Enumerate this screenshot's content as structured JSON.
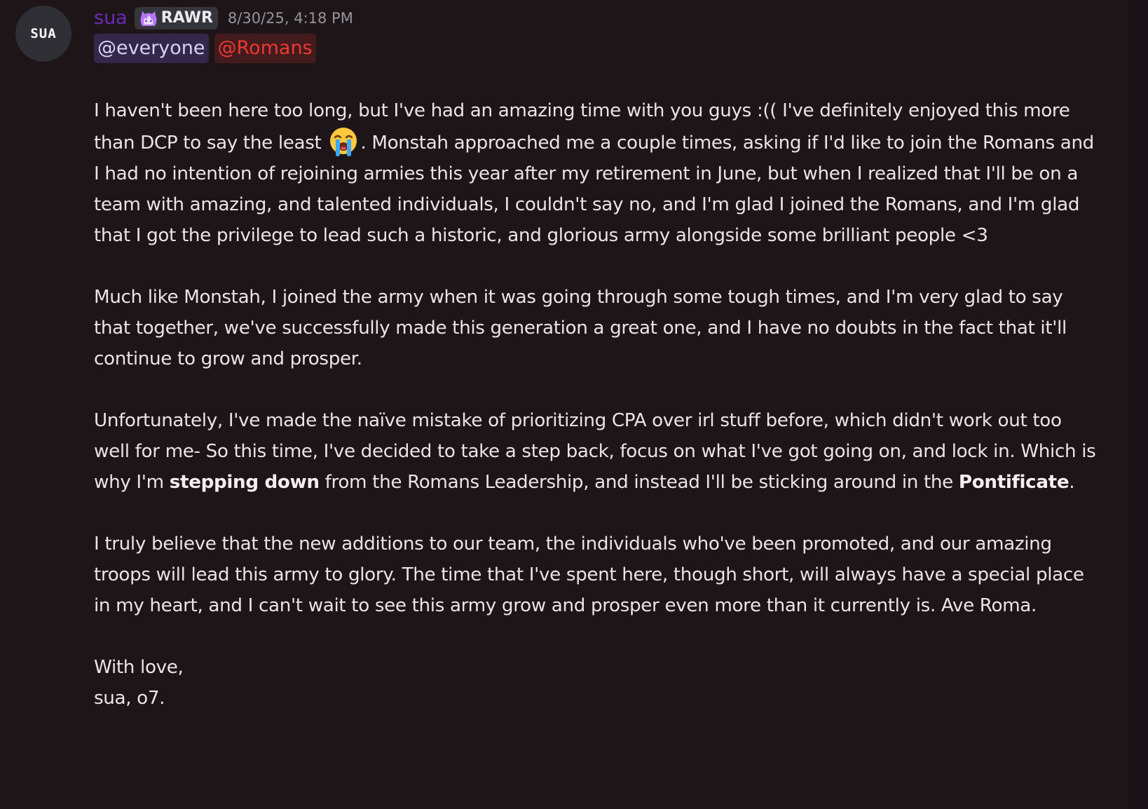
{
  "message": {
    "avatar_text": "SUA",
    "username": "sua",
    "tag_icon": "purple-flame-cat-icon",
    "tag_label": "RAWR",
    "timestamp": "8/30/25, 4:18 PM",
    "mentions": [
      "@everyone",
      "@Romans"
    ],
    "colors": {
      "username": "#6c2bb5",
      "role_mention": "#ea3a33",
      "everyone_mention_bg": "#33284a",
      "background": "#1e1519"
    },
    "paragraph1": {
      "text_a": "I haven't been here too long, but I've had an amazing time with you guys :(( I've definitely enjoyed this more than DCP to say the least ",
      "emoji": "loudly-crying-face-emoji",
      "text_b": ". Monstah approached me a couple times, asking if I'd like to join the Romans and I had no intention of rejoining armies this year after my retirement in June, but when I realized that I'll be on a team with amazing, and talented individuals, I couldn't say no, and I'm glad I joined the Romans, and I'm glad that I got the privilege to lead such a historic, and glorious army alongside some brilliant people <3"
    },
    "paragraph2": "Much like Monstah, I joined the army when it was going through some tough times, and I'm very glad to say that together, we've successfully made this generation a great one, and I have no doubts in the fact that it'll continue to grow and prosper.",
    "paragraph3": {
      "text_a": "Unfortunately, I've made the naïve mistake of prioritizing CPA over irl stuff before, which didn't work out too well for me- So this time, I've decided to take a step back, focus on what I've got going on, and lock in. Which is why I'm ",
      "bold_a": "stepping down",
      "text_b": " from the Romans Leadership, and instead I'll be sticking around in the ",
      "bold_b": "Pontificate",
      "text_c": "."
    },
    "paragraph4": "I truly believe that the new additions to our team, the individuals who've been promoted, and our amazing troops will lead this army to glory. The time that I've spent here, though short, will always have a special place in my heart, and I can't wait to see this army grow and prosper even more than it currently is. Ave Roma.",
    "signoff_line1": "With love,",
    "signoff_line2": "sua, o7."
  }
}
